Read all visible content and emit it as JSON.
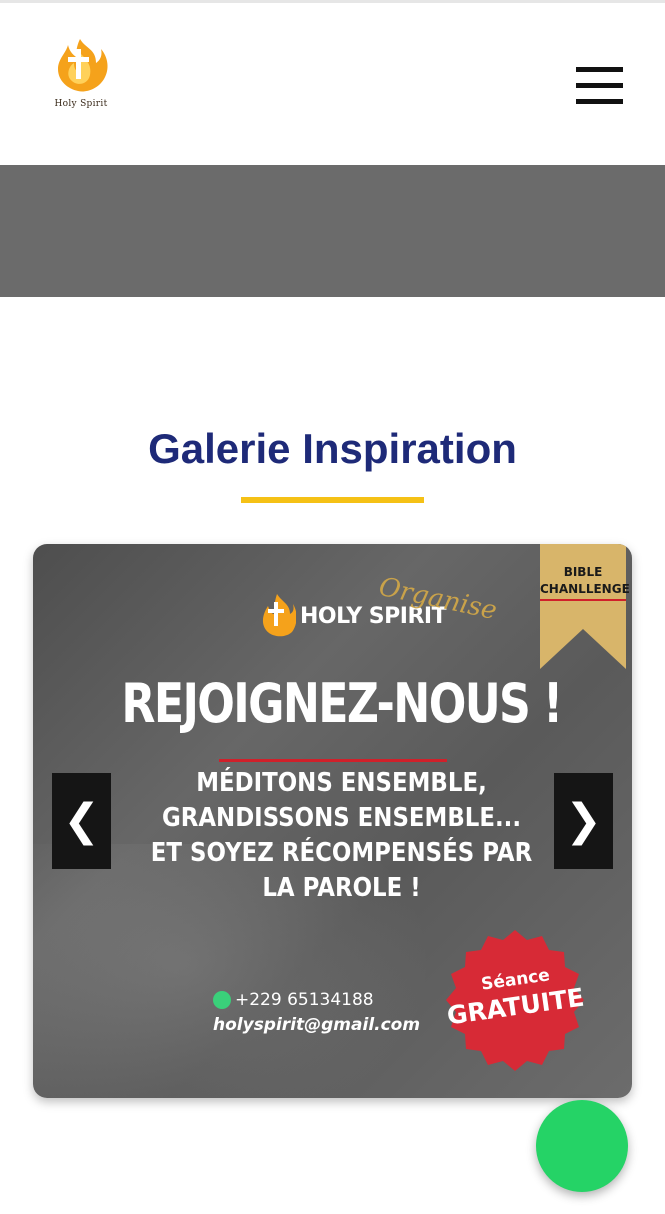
{
  "header": {
    "logo_text": "Holy Spirit",
    "menu_icon": "hamburger-menu-icon"
  },
  "section": {
    "title": "Galerie Inspiration",
    "underline_color": "#f5c116"
  },
  "carousel": {
    "slide": {
      "ribbon_line1": "BIBLE",
      "ribbon_line2": "CHANLLENGE",
      "brand_name": "HOLY SPIRIT",
      "brand_organise": "Organise",
      "headline": "REJOIGNEZ-NOUS !",
      "subtext_lines": [
        "MÉDITONS ENSEMBLE,",
        "GRANDISSONS ENSEMBLE...",
        "ET SOYEZ RÉCOMPENSÉS PAR",
        "LA PAROLE !"
      ],
      "phone": "+229 65134188",
      "email": "holyspirit@gmail.com",
      "badge_line1": "Séance",
      "badge_line2": "GRATUITE"
    },
    "prev_label": "❮",
    "next_label": "❯"
  },
  "fab": {
    "icon": "chat-icon",
    "color": "#25d366"
  },
  "colors": {
    "title": "#1e2a78",
    "banner": "#6b6b6b",
    "badge": "#d72a36",
    "ribbon": "#d8b56a"
  }
}
